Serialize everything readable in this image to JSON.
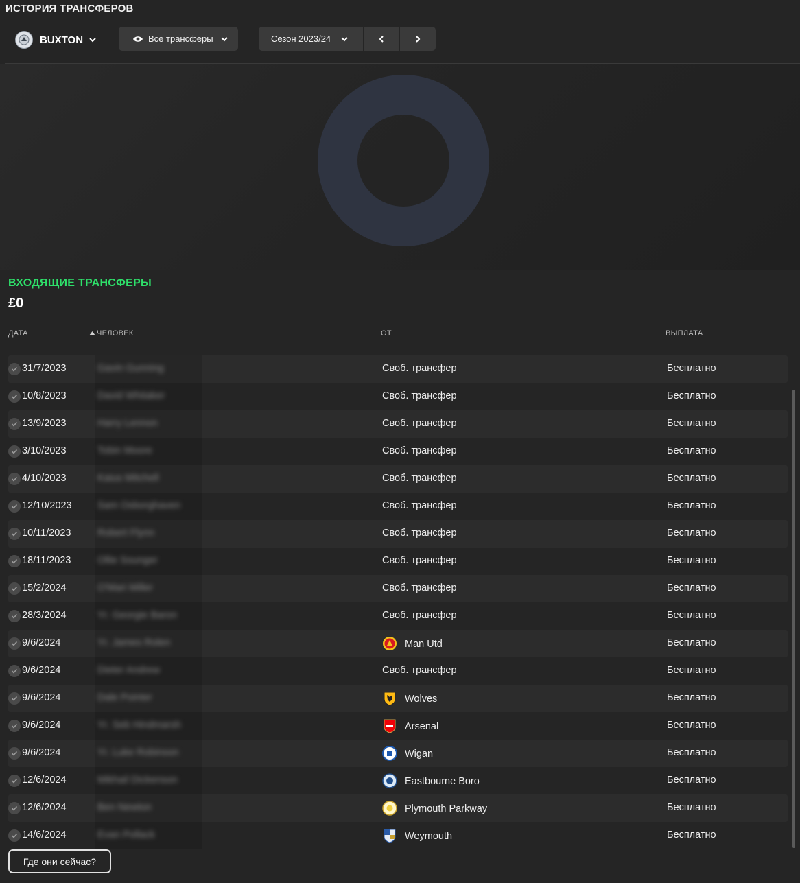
{
  "page_title": "ИСТОРИЯ ТРАНСФЕРОВ",
  "club": {
    "name": "BUXTON",
    "badge_icon": "club-badge-icon"
  },
  "filter": {
    "label": "Все трансферы",
    "icon": "eye-icon"
  },
  "season": {
    "label": "Сезон 2023/24"
  },
  "section": {
    "title": "ВХОДЯЩИЕ ТРАНСФЕРЫ",
    "total": "£0"
  },
  "columns": {
    "date": "ДАТА",
    "person": "ЧЕЛОВЕК",
    "from": "ОТ",
    "fee": "ВЫПЛАТА"
  },
  "transfers": [
    {
      "date": "31/7/2023",
      "person": "Gavin Gunning",
      "from": "Своб. трансфер",
      "fee": "Бесплатно"
    },
    {
      "date": "10/8/2023",
      "person": "David Whitaker",
      "from": "Своб. трансфер",
      "fee": "Бесплатно"
    },
    {
      "date": "13/9/2023",
      "person": "Harry Lennon",
      "from": "Своб. трансфер",
      "fee": "Бесплатно"
    },
    {
      "date": "3/10/2023",
      "person": "Tobin Moore",
      "from": "Своб. трансфер",
      "fee": "Бесплатно"
    },
    {
      "date": "4/10/2023",
      "person": "Kaius Mitchell",
      "from": "Своб. трансфер",
      "fee": "Бесплатно"
    },
    {
      "date": "12/10/2023",
      "person": "Sam Osborghaven",
      "from": "Своб. трансфер",
      "fee": "Бесплатно"
    },
    {
      "date": "10/11/2023",
      "person": "Robert Flynn",
      "from": "Своб. трансфер",
      "fee": "Бесплатно"
    },
    {
      "date": "18/11/2023",
      "person": "Ollie Sounger",
      "from": "Своб. трансфер",
      "fee": "Бесплатно"
    },
    {
      "date": "15/2/2024",
      "person": "O'Mari Miller",
      "from": "Своб. трансфер",
      "fee": "Бесплатно"
    },
    {
      "date": "28/3/2024",
      "person": "Yr. Georgie Baron",
      "from": "Своб. трансфер",
      "fee": "Бесплатно"
    },
    {
      "date": "9/6/2024",
      "person": "Yr. James Rolen",
      "from": "Man Utd",
      "fee": "Бесплатно",
      "crest": "man-utd"
    },
    {
      "date": "9/6/2024",
      "person": "Dieter Andrew",
      "from": "Своб. трансфер",
      "fee": "Бесплатно"
    },
    {
      "date": "9/6/2024",
      "person": "Dale Pointer",
      "from": "Wolves",
      "fee": "Бесплатно",
      "crest": "wolves"
    },
    {
      "date": "9/6/2024",
      "person": "Yr. Seb Hindmarsh",
      "from": "Arsenal",
      "fee": "Бесплатно",
      "crest": "arsenal"
    },
    {
      "date": "9/6/2024",
      "person": "Yr. Luke Robinson",
      "from": "Wigan",
      "fee": "Бесплатно",
      "crest": "wigan"
    },
    {
      "date": "12/6/2024",
      "person": "Mikhail Dickenson",
      "from": "Eastbourne Boro",
      "fee": "Бесплатно",
      "crest": "eastbourne"
    },
    {
      "date": "12/6/2024",
      "person": "Ben Newton",
      "from": "Plymouth Parkway",
      "fee": "Бесплатно",
      "crest": "plymouth-parkway"
    },
    {
      "date": "14/6/2024",
      "person": "Evan Pollack",
      "from": "Weymouth",
      "fee": "Бесплатно",
      "crest": "weymouth"
    }
  ],
  "where_button": "Где они сейчас?",
  "colors": {
    "accent_green": "#2ee06a",
    "donut": "#2f3441",
    "row_alt": "#2c2c2c"
  }
}
